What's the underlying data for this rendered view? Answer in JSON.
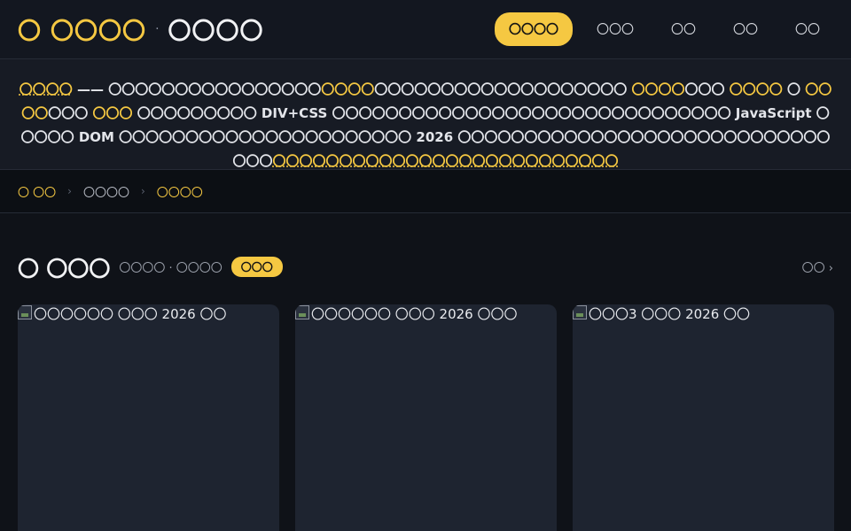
{
  "header": {
    "brand_title": "〇 〇〇〇〇",
    "brand_dot": "·",
    "brand_sub": "〇〇〇〇",
    "nav": [
      {
        "label": "〇〇〇〇",
        "active": true
      },
      {
        "label": "〇〇〇",
        "active": false
      },
      {
        "label": "〇〇",
        "active": false
      },
      {
        "label": "〇〇",
        "active": false
      },
      {
        "label": "〇〇",
        "active": false
      }
    ]
  },
  "intro": {
    "p1": "〇〇〇〇",
    "p2": " —— 〇〇〇〇〇〇〇〇〇〇〇〇〇〇〇〇",
    "p3": "〇〇〇〇",
    "p4": "〇〇〇〇〇〇〇〇〇〇〇〇〇〇〇〇〇〇〇 ",
    "p5": "〇〇〇〇",
    "p6": "〇〇〇 ",
    "p7": "〇〇〇〇",
    "p8": " 〇 ",
    "p9": "〇〇〇〇",
    "p10": "〇〇〇 ",
    "p11": "〇〇〇",
    "p12": " 〇〇〇〇〇〇〇〇〇 DIV+CSS 〇〇〇〇〇〇〇〇〇〇〇〇〇〇〇〇〇〇〇〇〇〇〇〇〇〇〇〇〇〇 JavaScript 〇〇〇〇〇 DOM 〇〇〇〇〇〇〇〇〇〇〇〇〇〇〇〇〇〇〇〇〇〇 2026 〇〇〇〇〇〇〇〇〇〇〇〇〇〇〇〇〇〇〇〇〇〇〇〇〇〇〇〇〇〇〇",
    "p13": "〇〇〇〇〇〇〇〇〇〇〇〇〇〇〇〇〇〇〇〇〇〇〇〇〇〇"
  },
  "breadcrumb": {
    "home": "〇 〇〇",
    "sep": "›",
    "mid": "〇〇〇〇",
    "current": "〇〇〇〇"
  },
  "section": {
    "title": "〇 〇〇〇",
    "subtitle": "〇〇〇〇 · 〇〇〇〇",
    "badge": "〇〇〇",
    "more": "〇〇 ›"
  },
  "cards": [
    {
      "alt": "〇〇〇〇〇〇 〇〇〇 2026 〇〇"
    },
    {
      "alt": "〇〇〇〇〇〇 〇〇〇 2026 〇〇〇"
    },
    {
      "alt": "〇〇〇3 〇〇〇 2026 〇〇"
    }
  ],
  "colors": {
    "accent": "#f5c842",
    "background": "#0f1218",
    "header_bg": "#131720",
    "card_bg": "#1e2430"
  },
  "icons": {
    "card_image": "broken-image-icon"
  }
}
